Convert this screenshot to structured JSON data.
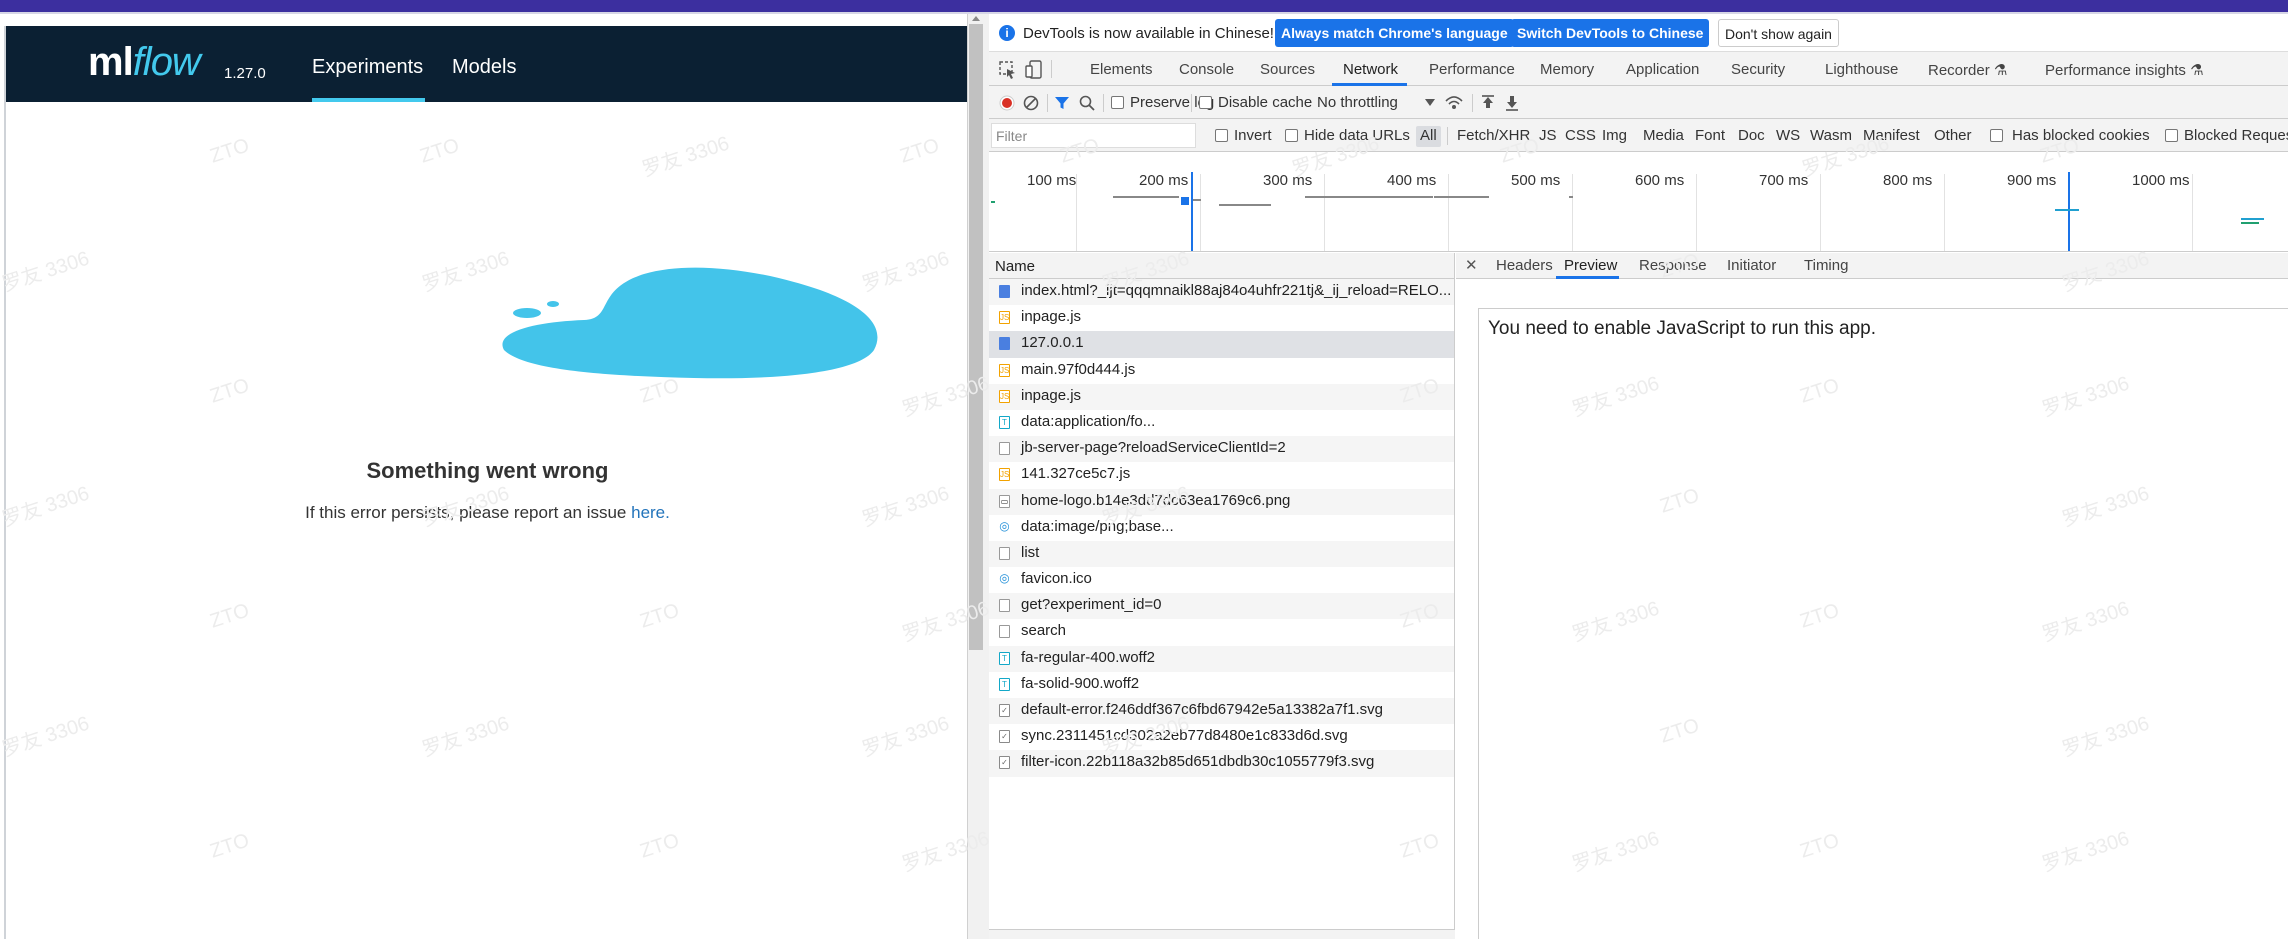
{
  "app": {
    "logo_main": "ml",
    "logo_flow": "flow",
    "version": "1.27.0",
    "nav": [
      "Experiments",
      "Models"
    ],
    "error_title": "Something went wrong",
    "error_msg": "If this error persists, please report an issue ",
    "error_link": "here."
  },
  "devtools": {
    "info": {
      "text": "DevTools is now available in Chinese!",
      "btn_match": "Always match Chrome's language",
      "btn_switch": "Switch DevTools to Chinese",
      "btn_dismiss": "Don't show again"
    },
    "tabs": [
      "Elements",
      "Console",
      "Sources",
      "Network",
      "Performance",
      "Memory",
      "Application",
      "Security",
      "Lighthouse",
      "Recorder ⚗",
      "Performance insights ⚗"
    ],
    "active_tab": "Network",
    "toolbar": {
      "preserve_log": "Preserve log",
      "disable_cache": "Disable cache",
      "throttling": "No throttling"
    },
    "filter": {
      "placeholder": "Filter",
      "invert": "Invert",
      "hide_data_urls": "Hide data URLs",
      "all": "All",
      "types": [
        "Fetch/XHR",
        "JS",
        "CSS",
        "Img",
        "Media",
        "Font",
        "Doc",
        "WS",
        "Wasm",
        "Manifest",
        "Other"
      ],
      "blocked_cookies": "Has blocked cookies",
      "blocked_requests": "Blocked Reques"
    },
    "overview_ticks": [
      "100 ms",
      "200 ms",
      "300 ms",
      "400 ms",
      "500 ms",
      "600 ms",
      "700 ms",
      "800 ms",
      "900 ms",
      "1000 ms"
    ],
    "name_header": "Name",
    "requests": [
      {
        "name": "index.html?_ijt=qqqmnaikl88aj84o4uhfr221tj&_ij_reload=RELO...",
        "type": "doc"
      },
      {
        "name": "inpage.js",
        "type": "js"
      },
      {
        "name": "127.0.0.1",
        "type": "doc"
      },
      {
        "name": "main.97f0d444.js",
        "type": "js"
      },
      {
        "name": "inpage.js",
        "type": "js"
      },
      {
        "name": "data:application/fo...",
        "type": "font"
      },
      {
        "name": "jb-server-page?reloadServiceClientId=2",
        "type": "other"
      },
      {
        "name": "141.327ce5c7.js",
        "type": "js"
      },
      {
        "name": "home-logo.b14e3dd7dc63ea1769c6.png",
        "type": "png"
      },
      {
        "name": "data:image/png;base...",
        "type": "img"
      },
      {
        "name": "list",
        "type": "other"
      },
      {
        "name": "favicon.ico",
        "type": "img"
      },
      {
        "name": "get?experiment_id=0",
        "type": "other"
      },
      {
        "name": "search",
        "type": "other"
      },
      {
        "name": "fa-regular-400.woff2",
        "type": "font"
      },
      {
        "name": "fa-solid-900.woff2",
        "type": "font"
      },
      {
        "name": "default-error.f246ddf367c6fbd67942e5a13382a7f1.svg",
        "type": "svg"
      },
      {
        "name": "sync.2311451cd302a2eb77d8480e1c833d6d.svg",
        "type": "svg"
      },
      {
        "name": "filter-icon.22b118a32b85d651dbdb30c1055779f3.svg",
        "type": "svg"
      }
    ],
    "selected_index": 2,
    "detail_tabs": [
      "Headers",
      "Preview",
      "Response",
      "Initiator",
      "Timing"
    ],
    "detail_active": "Preview",
    "preview_text": "You need to enable JavaScript to run this app."
  },
  "watermarks": [
    "ZTO",
    "罗友 3306"
  ]
}
